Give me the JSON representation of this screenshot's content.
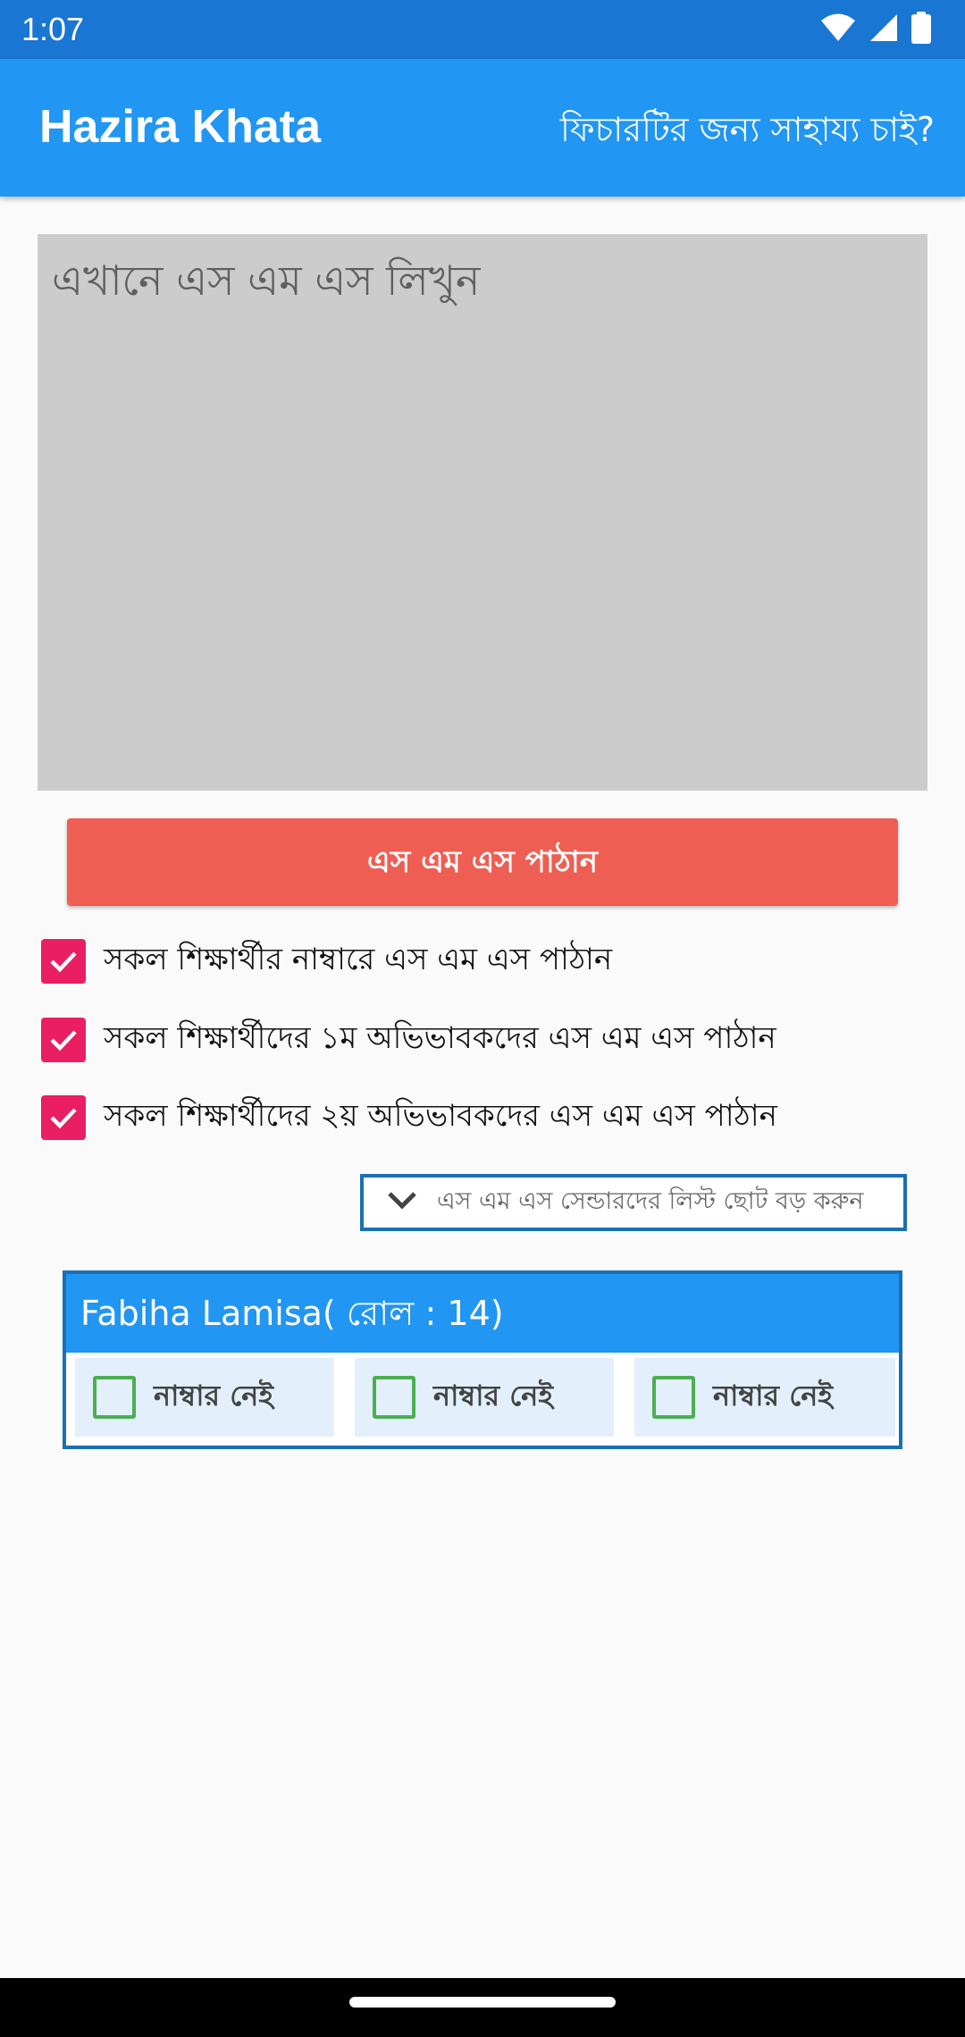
{
  "status_bar": {
    "time": "1:07",
    "icons": [
      "wifi-icon",
      "signal-icon",
      "battery-icon"
    ]
  },
  "app_bar": {
    "title": "Hazira Khata",
    "help_link": "ফিচারটির জন্য সাহায্য চাই?"
  },
  "sms_input": {
    "placeholder": "এখানে এস এম এস লিখুন",
    "value": ""
  },
  "send_button": {
    "label": "এস এম এস পাঠান"
  },
  "recipient_options": [
    {
      "label": "সকল শিক্ষার্থীর নাম্বারে এস এম এস পাঠান",
      "checked": true
    },
    {
      "label": "সকল শিক্ষার্থীদের ১ম অভিভাবকদের এস এম এস পাঠান",
      "checked": true
    },
    {
      "label": "সকল শিক্ষার্থীদের ২য় অভিভাবকদের এস এম এস পাঠান",
      "checked": true
    }
  ],
  "toggle_list": {
    "label": "এস এম এস সেন্ডারদের লিস্ট ছোট বড় করুন",
    "icon": "chevron-down-icon"
  },
  "students": [
    {
      "name": "Fabiha Lamisa( রোল : 14)",
      "numbers": [
        {
          "label": "নাম্বার নেই",
          "checked": false
        },
        {
          "label": "নাম্বার নেই",
          "checked": false
        },
        {
          "label": "নাম্বার নেই",
          "checked": false
        }
      ]
    }
  ],
  "colors": {
    "status_bar": "#1976d2",
    "app_bar": "#2196f3",
    "send_button": "#ee5e52",
    "checkbox_checked": "#e91e63",
    "number_checkbox": "#4caf50",
    "card_border": "#1a6fb5"
  }
}
